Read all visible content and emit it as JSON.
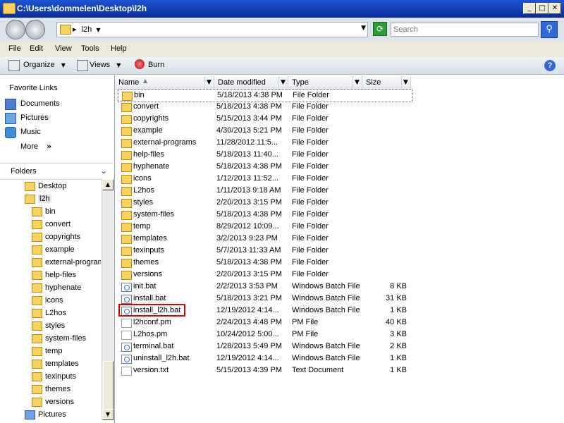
{
  "window": {
    "title": "C:\\Users\\dommelen\\Desktop\\l2h"
  },
  "address": {
    "crumb": "l2h",
    "sep": "▸"
  },
  "search": {
    "placeholder": "Search"
  },
  "menu": [
    {
      "label": "File",
      "key": "F"
    },
    {
      "label": "Edit",
      "key": "E"
    },
    {
      "label": "View",
      "key": "V"
    },
    {
      "label": "Tools",
      "key": "T"
    },
    {
      "label": "Help",
      "key": "H"
    }
  ],
  "toolbar": {
    "organize": "Organize",
    "views": "Views",
    "burn": "Burn"
  },
  "favorites": {
    "title": "Favorite Links",
    "items": [
      "Documents",
      "Pictures",
      "Music"
    ],
    "more": "More",
    "more_glyph": "»"
  },
  "folders_header": "Folders",
  "tree": [
    {
      "label": "Desktop",
      "indent": 0
    },
    {
      "label": "l2h",
      "indent": 1
    },
    {
      "label": "bin",
      "indent": 2
    },
    {
      "label": "convert",
      "indent": 2
    },
    {
      "label": "copyrights",
      "indent": 2
    },
    {
      "label": "example",
      "indent": 2
    },
    {
      "label": "external-program",
      "indent": 2
    },
    {
      "label": "help-files",
      "indent": 2
    },
    {
      "label": "hyphenate",
      "indent": 2
    },
    {
      "label": "icons",
      "indent": 2
    },
    {
      "label": "L2hos",
      "indent": 2
    },
    {
      "label": "styles",
      "indent": 2
    },
    {
      "label": "system-files",
      "indent": 2
    },
    {
      "label": "temp",
      "indent": 2
    },
    {
      "label": "templates",
      "indent": 2
    },
    {
      "label": "texinputs",
      "indent": 2
    },
    {
      "label": "themes",
      "indent": 2
    },
    {
      "label": "versions",
      "indent": 2
    },
    {
      "label": "Pictures",
      "indent": 0
    }
  ],
  "columns": {
    "name": "Name",
    "date": "Date modified",
    "type": "Type",
    "size": "Size"
  },
  "files": [
    {
      "name": "bin",
      "date": "5/18/2013 4:38 PM",
      "type": "File Folder",
      "size": "",
      "kind": "folder"
    },
    {
      "name": "convert",
      "date": "5/18/2013 4:38 PM",
      "type": "File Folder",
      "size": "",
      "kind": "folder"
    },
    {
      "name": "copyrights",
      "date": "5/15/2013 3:44 PM",
      "type": "File Folder",
      "size": "",
      "kind": "folder"
    },
    {
      "name": "example",
      "date": "4/30/2013 5:21 PM",
      "type": "File Folder",
      "size": "",
      "kind": "folder"
    },
    {
      "name": "external-programs",
      "date": "11/28/2012 11:5...",
      "type": "File Folder",
      "size": "",
      "kind": "folder"
    },
    {
      "name": "help-files",
      "date": "5/18/2013 11:40...",
      "type": "File Folder",
      "size": "",
      "kind": "folder"
    },
    {
      "name": "hyphenate",
      "date": "5/18/2013 4:38 PM",
      "type": "File Folder",
      "size": "",
      "kind": "folder"
    },
    {
      "name": "icons",
      "date": "1/12/2013 11:52...",
      "type": "File Folder",
      "size": "",
      "kind": "folder"
    },
    {
      "name": "L2hos",
      "date": "1/11/2013 9:18 AM",
      "type": "File Folder",
      "size": "",
      "kind": "folder"
    },
    {
      "name": "styles",
      "date": "2/20/2013 3:15 PM",
      "type": "File Folder",
      "size": "",
      "kind": "folder"
    },
    {
      "name": "system-files",
      "date": "5/18/2013 4:38 PM",
      "type": "File Folder",
      "size": "",
      "kind": "folder"
    },
    {
      "name": "temp",
      "date": "8/29/2012 10:09...",
      "type": "File Folder",
      "size": "",
      "kind": "folder"
    },
    {
      "name": "templates",
      "date": "3/2/2013 9:23 PM",
      "type": "File Folder",
      "size": "",
      "kind": "folder"
    },
    {
      "name": "texinputs",
      "date": "5/7/2013 11:33 AM",
      "type": "File Folder",
      "size": "",
      "kind": "folder"
    },
    {
      "name": "themes",
      "date": "5/18/2013 4:38 PM",
      "type": "File Folder",
      "size": "",
      "kind": "folder"
    },
    {
      "name": "versions",
      "date": "2/20/2013 3:15 PM",
      "type": "File Folder",
      "size": "",
      "kind": "folder"
    },
    {
      "name": "init.bat",
      "date": "2/2/2013 3:53 PM",
      "type": "Windows Batch File",
      "size": "8 KB",
      "kind": "bat"
    },
    {
      "name": "install.bat",
      "date": "5/18/2013 3:21 PM",
      "type": "Windows Batch File",
      "size": "31 KB",
      "kind": "bat"
    },
    {
      "name": "install_l2h.bat",
      "date": "12/19/2012 4:14...",
      "type": "Windows Batch File",
      "size": "1 KB",
      "kind": "bat"
    },
    {
      "name": "l2hconf.pm",
      "date": "2/24/2013 4:48 PM",
      "type": "PM File",
      "size": "40 KB",
      "kind": "file"
    },
    {
      "name": "L2hos.pm",
      "date": "10/24/2012 5:00...",
      "type": "PM File",
      "size": "3 KB",
      "kind": "file"
    },
    {
      "name": "terminal.bat",
      "date": "1/28/2013 5:49 PM",
      "type": "Windows Batch File",
      "size": "2 KB",
      "kind": "bat"
    },
    {
      "name": "uninstall_l2h.bat",
      "date": "12/19/2012 4:14...",
      "type": "Windows Batch File",
      "size": "1 KB",
      "kind": "bat"
    },
    {
      "name": "version.txt",
      "date": "5/15/2013 4:39 PM",
      "type": "Text Document",
      "size": "1 KB",
      "kind": "file"
    }
  ],
  "colors": {
    "titlebar": "#0a2ca0",
    "highlight": "#e00000",
    "folder": "#f7d35d"
  }
}
